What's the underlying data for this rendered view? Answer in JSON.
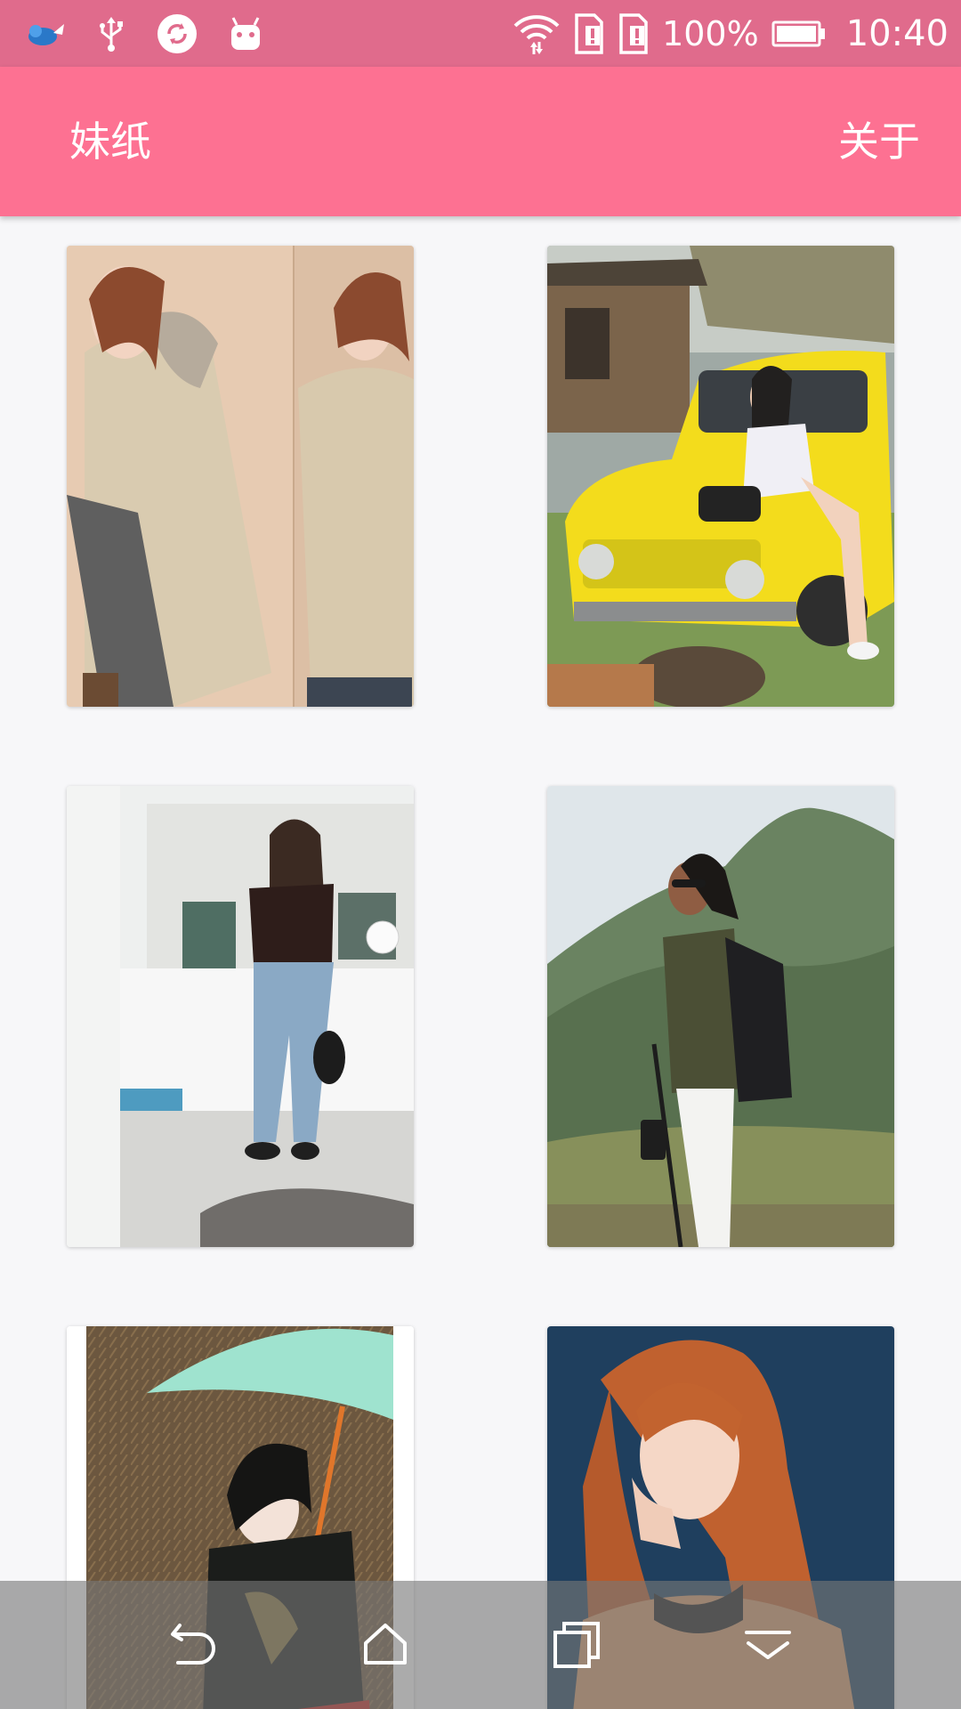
{
  "status_bar": {
    "battery_percent": "100%",
    "time": "10:40",
    "icons": [
      "notification-app-icon",
      "usb-icon",
      "sync-icon",
      "android-debug-icon",
      "wifi-icon",
      "sim-alert-icon",
      "sim-alert-icon",
      "battery-icon"
    ]
  },
  "app_bar": {
    "title": "妹纸",
    "about": "关于"
  },
  "grid": {
    "photos": [
      {
        "description": "woman in beige parka, two shots"
      },
      {
        "description": "woman sitting on yellow vintage truck"
      },
      {
        "description": "woman in jeans standing on rooftop"
      },
      {
        "description": "woman with backpack in front of mountains"
      },
      {
        "description": "woman with mint paper umbrella"
      },
      {
        "description": "woman with auburn hair on blue backdrop"
      }
    ]
  },
  "nav_bar": {
    "icons": [
      "back-icon",
      "home-icon",
      "recents-icon",
      "notification-shade-icon"
    ]
  },
  "colors": {
    "status_bar": "#e06b8c",
    "app_bar": "#fd7192",
    "background": "#f7f7f9"
  }
}
